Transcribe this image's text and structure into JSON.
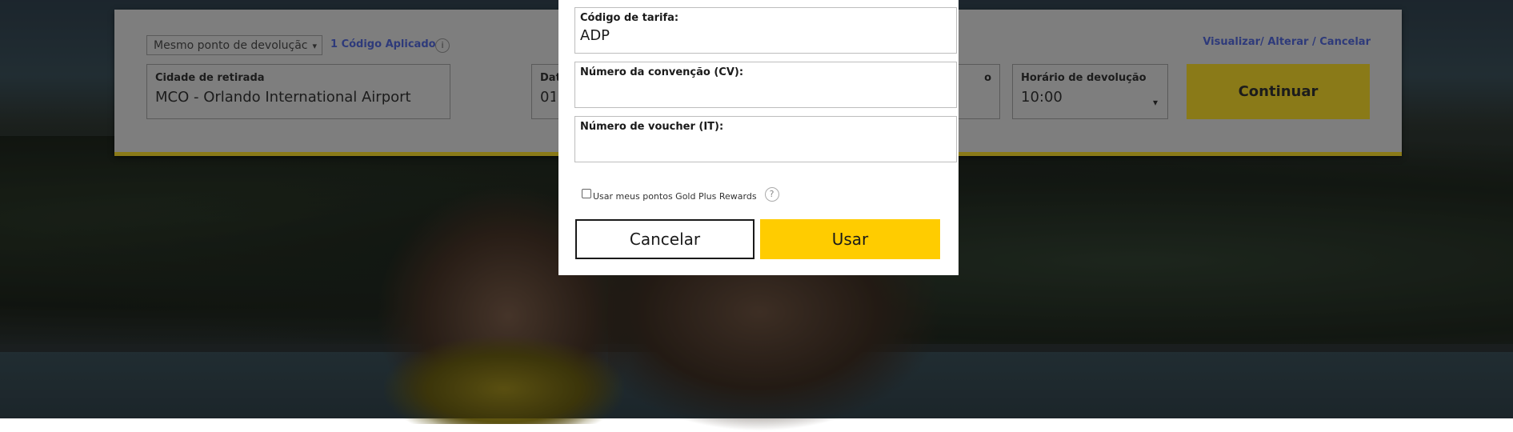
{
  "widget": {
    "dropoff_select": "Mesmo ponto de devoluçãc",
    "code_applied": "1 Código Aplicado",
    "info_icon": "i",
    "view_link": "Visualizar/ Alterar / Cancelar",
    "pickup_city_label": "Cidade de retirada",
    "pickup_city_value": "MCO - Orlando International Airport",
    "pickup_date_label": "Dat",
    "pickup_date_value": "01",
    "return_date_label_partial": "o",
    "return_time_label": "Horário de devolução",
    "return_time_value": "10:00",
    "continue_label": "Continuar"
  },
  "modal": {
    "rate_code_label": "Código de tarifa:",
    "rate_code_value": "ADP",
    "convention_label": "Número da convenção (CV):",
    "convention_value": "",
    "voucher_label": "Número de voucher (IT):",
    "voucher_value": "",
    "gold_plus_label": "Usar meus pontos Gold Plus Rewards",
    "gold_plus_help": "?",
    "cancel_label": "Cancelar",
    "use_label": "Usar"
  },
  "colors": {
    "brand_yellow": "#ffcc00",
    "link_blue": "#2e3a7a"
  }
}
